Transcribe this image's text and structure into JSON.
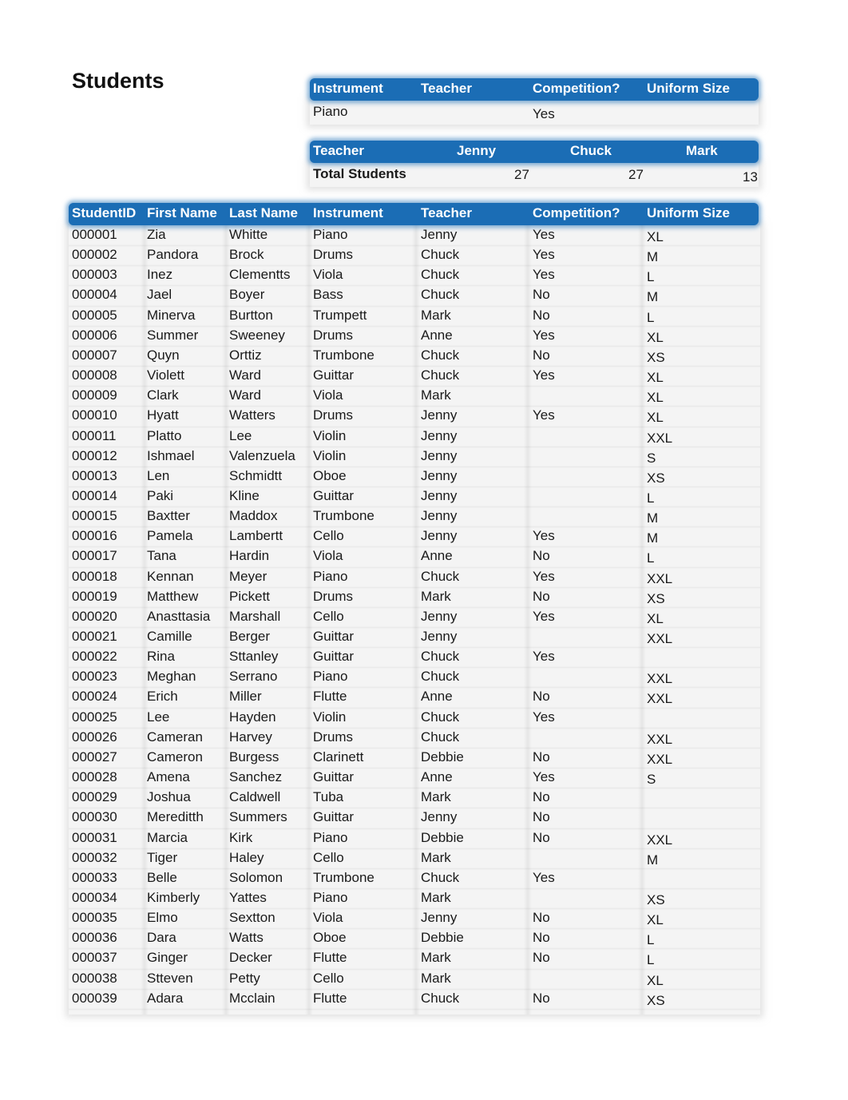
{
  "page_title": "Students",
  "filter_table": {
    "headers": [
      "Instrument",
      "Teacher",
      "Competition?",
      "Uniform Size"
    ],
    "values": [
      "Piano",
      "",
      "Yes",
      ""
    ]
  },
  "summary_table": {
    "header_label": "Teacher",
    "teachers": [
      "Jenny",
      "Chuck",
      "Mark"
    ],
    "row_label": "Total Students",
    "totals": [
      "27",
      "27",
      "13"
    ]
  },
  "students_table": {
    "headers": [
      "StudentID",
      "First Name",
      "Last Name",
      "Instrument",
      "Teacher",
      "Competition?",
      "Uniform Size"
    ],
    "rows": [
      [
        "000001",
        "Zia",
        "Whitte",
        "Piano",
        "Jenny",
        "Yes",
        "XL"
      ],
      [
        "000002",
        "Pandora",
        "Brock",
        "Drums",
        "Chuck",
        "Yes",
        "M"
      ],
      [
        "000003",
        "Inez",
        "Clementts",
        "Viola",
        "Chuck",
        "Yes",
        "L"
      ],
      [
        "000004",
        "Jael",
        "Boyer",
        "Bass",
        "Chuck",
        "No",
        "M"
      ],
      [
        "000005",
        "Minerva",
        "Burtton",
        "Trumpett",
        "Mark",
        "No",
        "L"
      ],
      [
        "000006",
        "Summer",
        "Sweeney",
        "Drums",
        "Anne",
        "Yes",
        "XL"
      ],
      [
        "000007",
        "Quyn",
        "Orttiz",
        "Trumbone",
        "Chuck",
        "No",
        "XS"
      ],
      [
        "000008",
        "Violett",
        "Ward",
        "Guittar",
        "Chuck",
        "Yes",
        "XL"
      ],
      [
        "000009",
        "Clark",
        "Ward",
        "Viola",
        "Mark",
        "",
        "XL"
      ],
      [
        "000010",
        "Hyatt",
        "Watters",
        "Drums",
        "Jenny",
        "Yes",
        "XL"
      ],
      [
        "000011",
        "Platto",
        "Lee",
        "Violin",
        "Jenny",
        "",
        "XXL"
      ],
      [
        "000012",
        "Ishmael",
        "Valenzuela",
        "Violin",
        "Jenny",
        "",
        "S"
      ],
      [
        "000013",
        "Len",
        "Schmidtt",
        "Oboe",
        "Jenny",
        "",
        "XS"
      ],
      [
        "000014",
        "Paki",
        "Kline",
        "Guittar",
        "Jenny",
        "",
        "L"
      ],
      [
        "000015",
        "Baxtter",
        "Maddox",
        "Trumbone",
        "Jenny",
        "",
        "M"
      ],
      [
        "000016",
        "Pamela",
        "Lambertt",
        "Cello",
        "Jenny",
        "Yes",
        "M"
      ],
      [
        "000017",
        "Tana",
        "Hardin",
        "Viola",
        "Anne",
        "No",
        "L"
      ],
      [
        "000018",
        "Kennan",
        "Meyer",
        "Piano",
        "Chuck",
        "Yes",
        "XXL"
      ],
      [
        "000019",
        "Matthew",
        "Pickett",
        "Drums",
        "Mark",
        "No",
        "XS"
      ],
      [
        "000020",
        "Anasttasia",
        "Marshall",
        "Cello",
        "Jenny",
        "Yes",
        "XL"
      ],
      [
        "000021",
        "Camille",
        "Berger",
        "Guittar",
        "Jenny",
        "",
        "XXL"
      ],
      [
        "000022",
        "Rina",
        "Sttanley",
        "Guittar",
        "Chuck",
        "Yes",
        ""
      ],
      [
        "000023",
        "Meghan",
        "Serrano",
        "Piano",
        "Chuck",
        "",
        "XXL"
      ],
      [
        "000024",
        "Erich",
        "Miller",
        "Flutte",
        "Anne",
        "No",
        "XXL"
      ],
      [
        "000025",
        "Lee",
        "Hayden",
        "Violin",
        "Chuck",
        "Yes",
        ""
      ],
      [
        "000026",
        "Cameran",
        "Harvey",
        "Drums",
        "Chuck",
        "",
        "XXL"
      ],
      [
        "000027",
        "Cameron",
        "Burgess",
        "Clarinett",
        "Debbie",
        "No",
        "XXL"
      ],
      [
        "000028",
        "Amena",
        "Sanchez",
        "Guittar",
        "Anne",
        "Yes",
        "S"
      ],
      [
        "000029",
        "Joshua",
        "Caldwell",
        "Tuba",
        "Mark",
        "No",
        ""
      ],
      [
        "000030",
        "Mereditth",
        "Summers",
        "Guittar",
        "Jenny",
        "No",
        ""
      ],
      [
        "000031",
        "Marcia",
        "Kirk",
        "Piano",
        "Debbie",
        "No",
        "XXL"
      ],
      [
        "000032",
        "Tiger",
        "Haley",
        "Cello",
        "Mark",
        "",
        "M"
      ],
      [
        "000033",
        "Belle",
        "Solomon",
        "Trumbone",
        "Chuck",
        "Yes",
        ""
      ],
      [
        "000034",
        "Kimberly",
        "Yattes",
        "Piano",
        "Mark",
        "",
        "XS"
      ],
      [
        "000035",
        "Elmo",
        "Sextton",
        "Viola",
        "Jenny",
        "No",
        "XL"
      ],
      [
        "000036",
        "Dara",
        "Watts",
        "Oboe",
        "Debbie",
        "No",
        "L"
      ],
      [
        "000037",
        "Ginger",
        "Decker",
        "Flutte",
        "Mark",
        "No",
        "L"
      ],
      [
        "000038",
        "Stteven",
        "Petty",
        "Cello",
        "Mark",
        "",
        "XL"
      ],
      [
        "000039",
        "Adara",
        "Mcclain",
        "Flutte",
        "Chuck",
        "No",
        "XS"
      ]
    ]
  }
}
